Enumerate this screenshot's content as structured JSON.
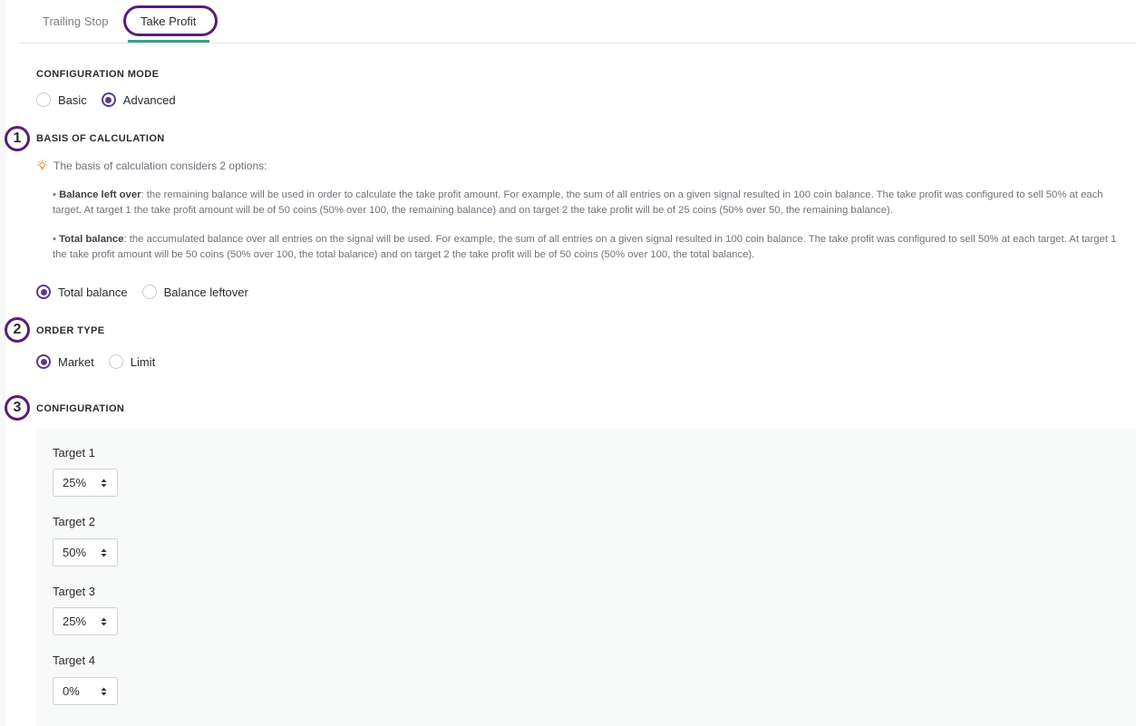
{
  "tabs": [
    {
      "label": "Trailing Stop",
      "active": false
    },
    {
      "label": "Take Profit",
      "active": true
    }
  ],
  "configuration_mode": {
    "title": "CONFIGURATION MODE",
    "options": [
      "Basic",
      "Advanced"
    ],
    "selected": "Advanced"
  },
  "markers": [
    "1",
    "2",
    "3"
  ],
  "basis_of_calculation": {
    "title": "BASIS OF CALCULATION",
    "info": "The basis of calculation considers 2 options:",
    "balance_left_over": {
      "label": "Balance left over",
      "text": ": the remaining balance will be used in order to calculate the take profit amount. For example, the sum of all entries on a given signal resulted in 100 coin balance. The take profit was configured to sell 50% at each target. At target 1 the take profit amount will be of 50 coins (50% over 100, the remaining balance) and on target 2 the take profit will be of 25 coins (50% over 50, the remaining balance)."
    },
    "total_balance": {
      "label": "Total balance",
      "text": ": the accumulated balance over all entries on the signal will be used. For example, the sum of all entries on a given signal resulted in 100 coin balance. The take profit was configured to sell 50% at each target. At target 1 the take profit amount will be 50 coins (50% over 100, the total balance) and on target 2 the take profit will be of 50 coins (50% over 100, the total balance)."
    },
    "options": [
      "Total balance",
      "Balance leftover"
    ],
    "selected": "Total balance"
  },
  "order_type": {
    "title": "ORDER TYPE",
    "options": [
      "Market",
      "Limit"
    ],
    "selected": "Market"
  },
  "configuration": {
    "title": "CONFIGURATION",
    "targets": [
      {
        "label": "Target 1",
        "value": "25%"
      },
      {
        "label": "Target 2",
        "value": "50%"
      },
      {
        "label": "Target 3",
        "value": "25%"
      },
      {
        "label": "Target 4",
        "value": "0%"
      }
    ]
  },
  "colors": {
    "accent": "#5b3a86",
    "annotation_ring": "#5a1d7a",
    "tab_underline": "#3a9e8f",
    "bulb": "#f29a4a"
  }
}
